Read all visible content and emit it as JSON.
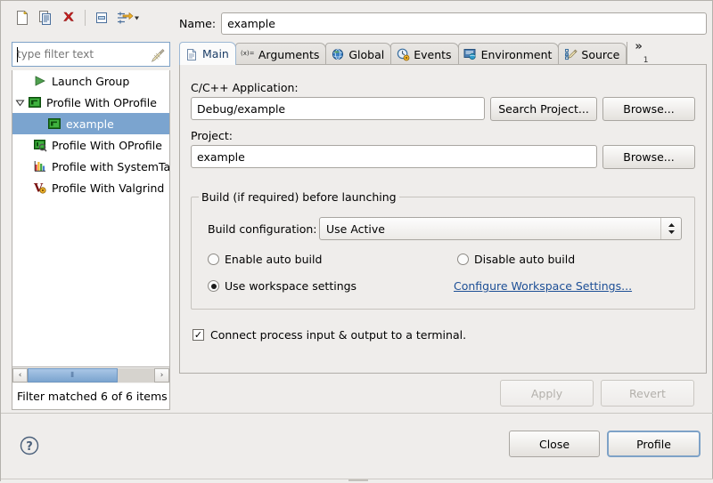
{
  "window": {
    "background_color": "#efedeb",
    "border_color": "#b4b1ac"
  },
  "theme": {
    "selection_color": "#7ba4cf",
    "link_color": "#1d4f96",
    "accent_border": "#7ea2c7",
    "delete_icon_color": "#cc2222"
  },
  "toolbar": {
    "buttons": [
      {
        "name": "new-launch-configuration-icon",
        "tooltip": "New launch configuration"
      },
      {
        "name": "duplicate-launch-configuration-icon",
        "tooltip": "Duplicate"
      },
      {
        "name": "delete-launch-configuration-icon",
        "tooltip": "Delete"
      },
      {
        "name": "collapse-all-icon",
        "tooltip": "Collapse All"
      },
      {
        "name": "filter-launch-configurations-icon",
        "tooltip": "Filter"
      }
    ]
  },
  "filter": {
    "value": "",
    "placeholder": "type filter text",
    "clear_icon": "clear-filter-icon",
    "status": "Filter matched 6 of 6 items"
  },
  "tree": {
    "items": [
      {
        "label": "Launch Group",
        "icon": "launch-group-icon",
        "indent": 1,
        "twisty": "",
        "selected": false
      },
      {
        "label": "Profile With OProfile",
        "icon": "oprofile-icon",
        "indent": 0,
        "twisty": "expanded",
        "selected": false
      },
      {
        "label": "example",
        "icon": "oprofile-icon",
        "indent": 2,
        "twisty": "",
        "selected": true
      },
      {
        "label": "Profile With OProfile",
        "icon": "oprofile-manual-icon",
        "indent": 1,
        "twisty": "",
        "selected": false
      },
      {
        "label": "Profile with SystemTap",
        "icon": "systemtap-icon",
        "indent": 1,
        "twisty": "",
        "selected": false
      },
      {
        "label": "Profile With Valgrind",
        "icon": "valgrind-icon",
        "indent": 1,
        "twisty": "",
        "selected": false
      }
    ]
  },
  "scrollbar": {
    "left_arrow": "‹",
    "right_arrow": "›",
    "grip": "⫴"
  },
  "name_row": {
    "label": "Name:",
    "value": "example",
    "placeholder": ""
  },
  "tabs": [
    {
      "label": "Main",
      "icon": "document-icon",
      "active": true
    },
    {
      "label": "Arguments",
      "icon": "arguments-variable-icon",
      "active": false
    },
    {
      "label": "Global",
      "icon": "globe-icon",
      "active": false
    },
    {
      "label": "Events",
      "icon": "events-clock-icon",
      "active": false
    },
    {
      "label": "Environment",
      "icon": "environment-icon",
      "active": false
    },
    {
      "label": "Source",
      "icon": "source-edit-icon",
      "active": false
    }
  ],
  "tab_overflow": {
    "chevron": "»",
    "count": "1"
  },
  "main_tab": {
    "application_label": "C/C++ Application:",
    "application_value": "Debug/example",
    "search_project_button": "Search Project...",
    "browse_application_button": "Browse...",
    "project_label": "Project:",
    "project_value": "example",
    "browse_project_button": "Browse...",
    "build_group_title": "Build (if required) before launching",
    "build_configuration_label": "Build configuration:",
    "build_configuration_value": "Use Active",
    "radio_enable_auto_build": "Enable auto build",
    "radio_disable_auto_build": "Disable auto build",
    "radio_use_workspace_settings": "Use workspace settings",
    "configure_workspace_link": "Configure Workspace Settings...",
    "terminal_checkbox_label": "Connect process input & output to a terminal.",
    "terminal_checkbox_checked": true,
    "terminal_checkbox_glyph": "✓",
    "selected_build_radio": "use_workspace_settings"
  },
  "action_row": {
    "apply_label": "Apply",
    "apply_enabled": false,
    "revert_label": "Revert",
    "revert_enabled": false
  },
  "footer": {
    "help_icon": "help-question-icon",
    "close_label": "Close",
    "profile_label": "Profile",
    "default_button": "Profile"
  }
}
